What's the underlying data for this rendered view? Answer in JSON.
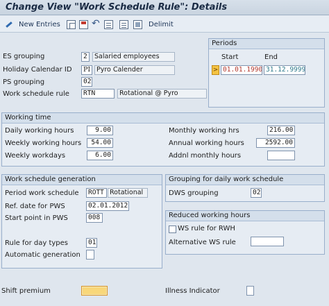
{
  "window": {
    "title": "Change View \"Work Schedule Rule\": Details"
  },
  "toolbar": {
    "new_entries": "New Entries",
    "delimit": "Delimit",
    "icons": [
      "pencil-icon",
      "copy-icon",
      "save-icon",
      "undo-icon",
      "doc-icon",
      "doc2-icon",
      "delete-icon"
    ]
  },
  "header": {
    "es_grouping_label": "ES grouping",
    "es_grouping_value": "2",
    "es_grouping_text": "Salaried employees",
    "holiday_label": "Holiday Calendar ID",
    "holiday_value": "PI",
    "holiday_text": "Pyro Calender",
    "ps_label": "PS grouping",
    "ps_value": "02",
    "wsr_label": "Work schedule rule",
    "wsr_value": "RTN",
    "wsr_text": "Rotational @ Pyro"
  },
  "periods": {
    "title": "Periods",
    "start_label": "Start",
    "end_label": "End",
    "selector": ">",
    "start_value": "01.01.1990",
    "end_value": "31.12.9999"
  },
  "working_time": {
    "title": "Working time",
    "daily_label": "Daily working hours",
    "daily_value": "9.00",
    "weekly_label": "Weekly working hours",
    "weekly_value": "54.00",
    "workdays_label": "Weekly workdays",
    "workdays_value": "6.00",
    "monthly_label": "Monthly working hrs",
    "monthly_value": "216.00",
    "annual_label": "Annual working hours",
    "annual_value": "2592.00",
    "addnl_label": "Addnl monthly hours",
    "addnl_value": ""
  },
  "generation": {
    "title": "Work schedule generation",
    "period_label": "Period work schedule",
    "period_value": "ROTT",
    "period_text": "Rotational",
    "ref_label": "Ref. date for PWS",
    "ref_value": "02.01.2012",
    "start_label": "Start point in PWS",
    "start_value": "008",
    "rule_label": "Rule for day types",
    "rule_value": "01",
    "auto_label": "Automatic generation",
    "auto_value": ""
  },
  "dws": {
    "title": "Grouping for daily work schedule",
    "label": "DWS grouping",
    "value": "02"
  },
  "reduced": {
    "title": "Reduced working hours",
    "ws_rule_label": "WS rule for RWH",
    "alt_label": "Alternative WS rule",
    "alt_value": ""
  },
  "footer": {
    "shift_label": "Shift premium",
    "illness_label": "Illness Indicator"
  }
}
